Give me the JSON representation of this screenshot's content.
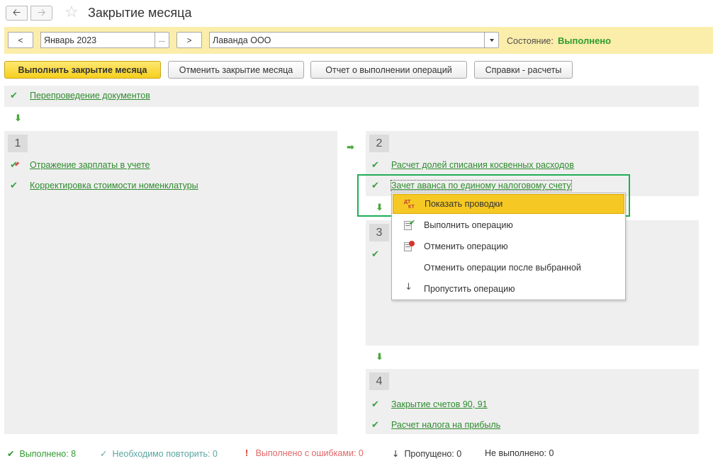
{
  "window": {
    "title": "Закрытие месяца"
  },
  "period": {
    "prev_label": "<",
    "value": "Январь 2023",
    "select_label": "...",
    "next_label": ">",
    "organization": "Лаванда ООО",
    "state_label": "Состояние:",
    "state_value": "Выполнено"
  },
  "toolbar": {
    "run": "Выполнить закрытие месяца",
    "cancel": "Отменить закрытие месяца",
    "report": "Отчет о выполнении операций",
    "references": "Справки - расчеты"
  },
  "steps": {
    "pre": {
      "link": "Перепроведение документов"
    },
    "s1": {
      "num": "1",
      "items": [
        "Отражение зарплаты в учете",
        "Корректировка стоимости номенклатуры"
      ]
    },
    "s2": {
      "num": "2",
      "items": [
        "Расчет долей списания косвенных расходов",
        "Зачет аванса по единому налоговому счету"
      ]
    },
    "s3": {
      "num": "3"
    },
    "s4": {
      "num": "4",
      "items": [
        "Закрытие счетов 90, 91",
        "Расчет налога на прибыль"
      ]
    }
  },
  "context_menu": {
    "items": [
      {
        "label": "Показать проводки",
        "icon": "dt-kt-icon"
      },
      {
        "label": "Выполнить операцию",
        "icon": "run-operation-icon"
      },
      {
        "label": "Отменить операцию",
        "icon": "cancel-operation-icon"
      },
      {
        "label": "Отменить операции после выбранной",
        "icon": ""
      },
      {
        "label": "Пропустить операцию",
        "icon": "arrow-down-icon"
      }
    ]
  },
  "status": {
    "done_label": "Выполнено:",
    "done_count": "8",
    "repeat_label": "Необходимо повторить:",
    "repeat_count": "0",
    "errors_label": "Выполнено с ошибками:",
    "errors_count": "0",
    "skipped_label": "Пропущено:",
    "skipped_count": "0",
    "notdone_label": "Не выполнено:",
    "notdone_count": "0"
  },
  "colors": {
    "accent_yellow": "#f5cf1d",
    "period_bar": "#fbedaa",
    "success_green": "#2e9b2e",
    "highlight_frame": "#1fae57"
  }
}
